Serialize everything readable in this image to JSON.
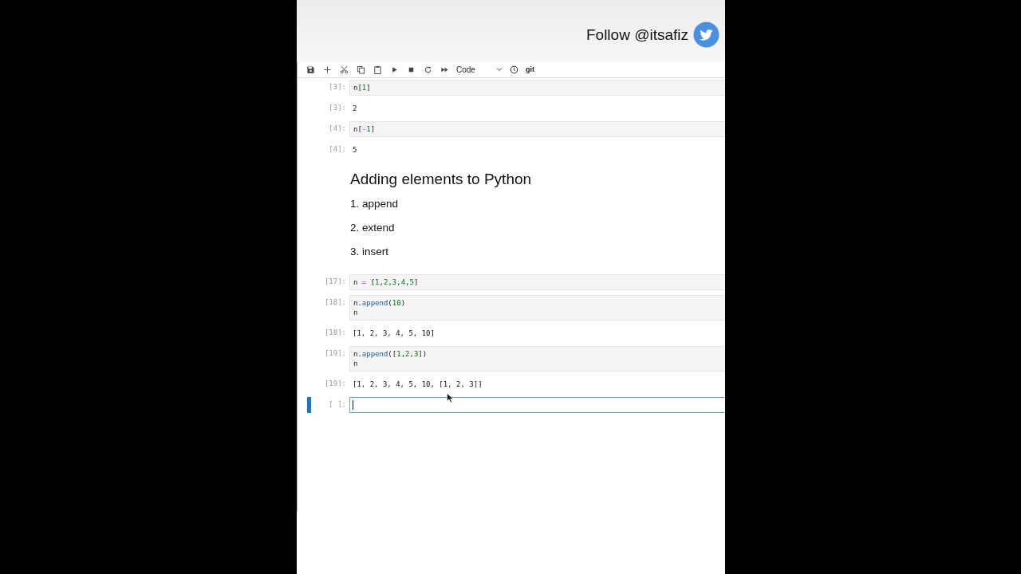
{
  "banner": {
    "text": "Follow @itsafiz"
  },
  "toolbar": {
    "cell_type": "Code",
    "git_label": "git"
  },
  "cells": [
    {
      "kind": "input",
      "prompt": "[3]:",
      "lines": [
        [
          {
            "t": "n[",
            "kind": "plain"
          },
          {
            "t": "1",
            "kind": "number"
          },
          {
            "t": "]",
            "kind": "plain"
          }
        ]
      ]
    },
    {
      "kind": "output",
      "prompt": "[3]:",
      "text": "2"
    },
    {
      "kind": "input",
      "prompt": "[4]:",
      "lines": [
        [
          {
            "t": "n[",
            "kind": "plain"
          },
          {
            "t": "-",
            "kind": "operator"
          },
          {
            "t": "1",
            "kind": "number"
          },
          {
            "t": "]",
            "kind": "plain"
          }
        ]
      ]
    },
    {
      "kind": "output",
      "prompt": "[4]:",
      "text": "5"
    },
    {
      "kind": "markdown",
      "heading": "Adding elements to Python",
      "items": [
        "1. append",
        "2. extend",
        "3. insert"
      ]
    },
    {
      "kind": "input",
      "prompt": "[17]:",
      "lines": [
        [
          {
            "t": "n ",
            "kind": "plain"
          },
          {
            "t": "=",
            "kind": "operator"
          },
          {
            "t": " [",
            "kind": "plain"
          },
          {
            "t": "1",
            "kind": "number"
          },
          {
            "t": ",",
            "kind": "plain"
          },
          {
            "t": "2",
            "kind": "number"
          },
          {
            "t": ",",
            "kind": "plain"
          },
          {
            "t": "3",
            "kind": "number"
          },
          {
            "t": ",",
            "kind": "plain"
          },
          {
            "t": "4",
            "kind": "number"
          },
          {
            "t": ",",
            "kind": "plain"
          },
          {
            "t": "5",
            "kind": "number"
          },
          {
            "t": "]",
            "kind": "plain"
          }
        ]
      ]
    },
    {
      "kind": "input",
      "prompt": "[18]:",
      "lines": [
        [
          {
            "t": "n.",
            "kind": "plain"
          },
          {
            "t": "append",
            "kind": "function"
          },
          {
            "t": "(",
            "kind": "plain"
          },
          {
            "t": "10",
            "kind": "number"
          },
          {
            "t": ")",
            "kind": "plain"
          }
        ],
        [
          {
            "t": "n",
            "kind": "plain"
          }
        ]
      ]
    },
    {
      "kind": "output",
      "prompt": "[18]:",
      "text": "[1, 2, 3, 4, 5, 10]"
    },
    {
      "kind": "input",
      "prompt": "[19]:",
      "lines": [
        [
          {
            "t": "n.",
            "kind": "plain"
          },
          {
            "t": "append",
            "kind": "function"
          },
          {
            "t": "([",
            "kind": "plain"
          },
          {
            "t": "1",
            "kind": "number"
          },
          {
            "t": ",",
            "kind": "plain"
          },
          {
            "t": "2",
            "kind": "number"
          },
          {
            "t": ",",
            "kind": "plain"
          },
          {
            "t": "3",
            "kind": "number"
          },
          {
            "t": "])",
            "kind": "plain"
          }
        ],
        [
          {
            "t": "n",
            "kind": "plain"
          }
        ]
      ]
    },
    {
      "kind": "output",
      "prompt": "[19]:",
      "text": "[1, 2, 3, 4, 5, 10, [1, 2, 3]]"
    },
    {
      "kind": "active",
      "prompt": "[ ]:",
      "selected": true
    }
  ]
}
